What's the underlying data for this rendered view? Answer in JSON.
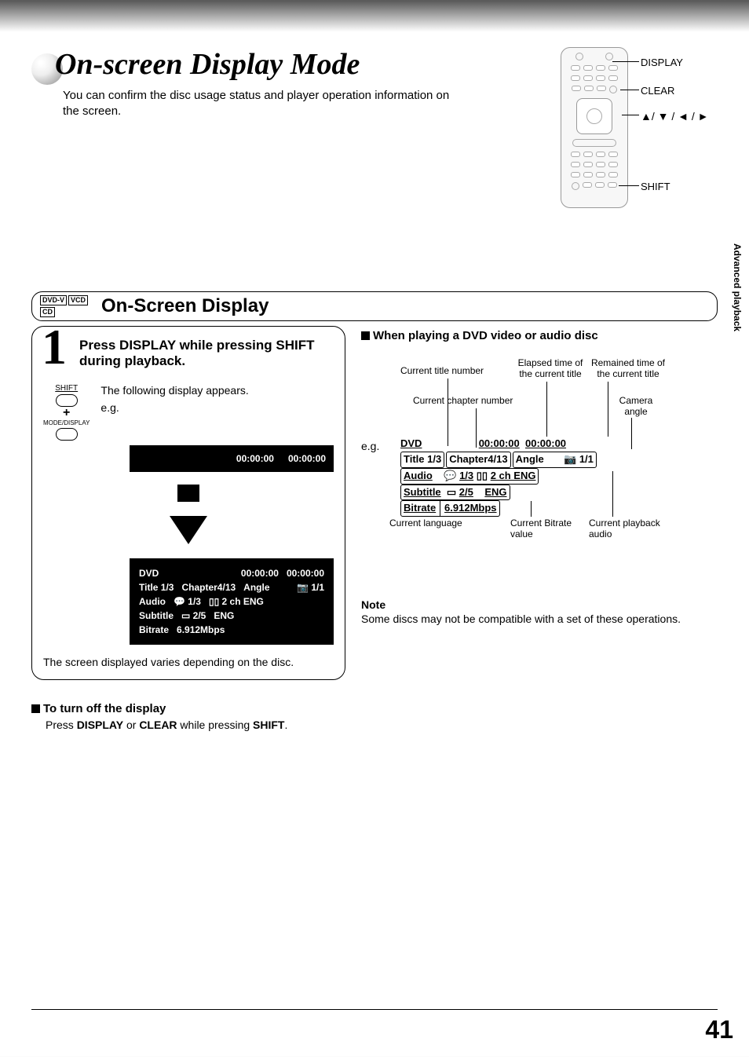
{
  "header": {
    "title": "On-screen Display Mode",
    "subtitle": "You can confirm the disc usage status and player operation information on the screen."
  },
  "remote_labels": {
    "display": "DISPLAY",
    "clear": "CLEAR",
    "arrows": "▲/ ▼ / ◄ / ►",
    "shift": "SHIFT"
  },
  "section": {
    "badges": [
      "DVD-V",
      "VCD",
      "CD"
    ],
    "title": "On-Screen Display"
  },
  "step": {
    "num": "1",
    "text": "Press DISPLAY while pressing SHIFT during playback.",
    "shift_label": "SHIFT",
    "mode_label": "MODE/DISPLAY",
    "following": "The following display appears.",
    "eg": "e.g."
  },
  "osd_bar": {
    "t1": "00:00:00",
    "t2": "00:00:00"
  },
  "osd_full": {
    "l1a": "DVD",
    "l1b": "00:00:00",
    "l1c": "00:00:00",
    "l2a": "Title 1/3",
    "l2b": "Chapter4/13",
    "l2c": "Angle",
    "l2d": "1/1",
    "l3a": "Audio",
    "l3b": "1/3",
    "l3c": "2 ch ENG",
    "l4a": "Subtitle",
    "l4b": "2/5",
    "l4c": "ENG",
    "l5a": "Bitrate",
    "l5b": "6.912Mbps"
  },
  "vary": "The screen displayed varies depending on the disc.",
  "right": {
    "header": "When playing a DVD video or audio disc",
    "eg": "e.g.",
    "ann_title": "Current title number",
    "ann_chapter": "Current chapter number",
    "ann_elapsed": "Elapsed time of the current title",
    "ann_remain": "Remained time of the current title",
    "ann_camera": "Camera angle",
    "ann_lang": "Current language",
    "ann_bitrate": "Current Bitrate value",
    "ann_audio": "Current playback audio"
  },
  "osd2": {
    "dvd": "DVD",
    "t1": "00:00:00",
    "t2": "00:00:00",
    "title": "Title 1/3",
    "chapter": "Chapter4/13",
    "angle": "Angle",
    "angval": "1/1",
    "audio": "Audio",
    "av": "1/3",
    "ach": "2 ch ENG",
    "sub": "Subtitle",
    "sv": "2/5",
    "sl": "ENG",
    "br": "Bitrate",
    "brv": "6.912Mbps"
  },
  "note": {
    "title": "Note",
    "body": "Some discs may not be compatible with a set of these operations."
  },
  "turnoff": {
    "head": "To turn off the display",
    "body_pre": "Press ",
    "d": "DISPLAY",
    "mid": " or ",
    "c": "CLEAR",
    "mid2": " while pressing ",
    "s": "SHIFT",
    "end": "."
  },
  "side": "Advanced playback",
  "page": "41"
}
